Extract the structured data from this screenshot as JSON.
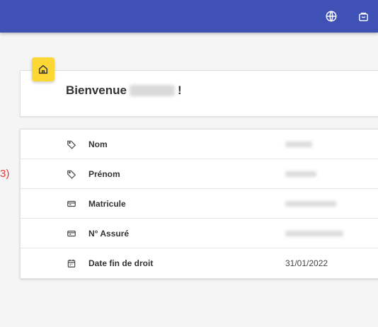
{
  "header": {
    "language_icon": "globe-icon",
    "cart_icon": "shopping-bag-icon",
    "brand_color": "#3f51b5"
  },
  "welcome": {
    "greeting": "Bienvenue",
    "exclamation": "!",
    "badge_icon": "home-icon",
    "badge_color": "#fdd835"
  },
  "side_fragment": "3)",
  "info": {
    "rows": [
      {
        "icon": "tag-icon",
        "label": "Nom",
        "value": "",
        "blurred": true
      },
      {
        "icon": "tag-icon",
        "label": "Prénom",
        "value": "",
        "blurred": true
      },
      {
        "icon": "card-icon",
        "label": "Matricule",
        "value": "",
        "blurred": true
      },
      {
        "icon": "card-icon",
        "label": "N° Assuré",
        "value": "",
        "blurred": true
      },
      {
        "icon": "calendar-icon",
        "label": "Date fin de droit",
        "value": "31/01/2022",
        "blurred": false
      }
    ]
  }
}
